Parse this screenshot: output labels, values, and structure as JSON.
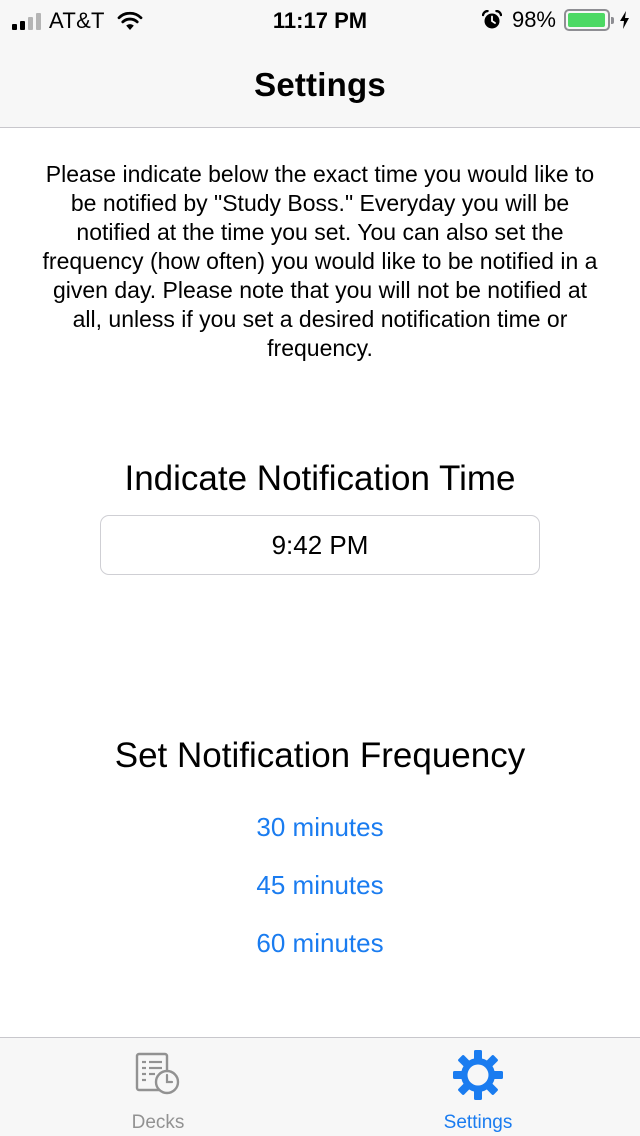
{
  "status_bar": {
    "carrier": "AT&T",
    "time": "11:17 PM",
    "battery_percent": "98%",
    "battery_level": 0.98,
    "signal_bars_filled": 2,
    "signal_bars_total": 4,
    "icons": [
      "signal-icon",
      "wifi-icon",
      "alarm-icon",
      "battery-icon",
      "charging-icon"
    ]
  },
  "nav_bar": {
    "title": "Settings"
  },
  "main": {
    "intro_text": "Please indicate below the exact time you would like to be notified by \"Study Boss.\" Everyday you will be notified at the time you set. You can also set the frequency (how often) you would like to be notified in a given day. Please note that you will not be notified at all, unless if you set a desired notification time or frequency.",
    "time_section_title": "Indicate Notification Time",
    "notification_time": "9:42 PM",
    "frequency_section_title": "Set Notification Frequency",
    "frequency_options": [
      "30 minutes",
      "45 minutes",
      "60 minutes"
    ]
  },
  "tab_bar": {
    "tabs": [
      {
        "label": "Decks",
        "icon": "decks-icon",
        "active": false
      },
      {
        "label": "Settings",
        "icon": "gear-icon",
        "active": true
      }
    ]
  },
  "colors": {
    "accent": "#1a7cf0",
    "inactive_tab": "#929292",
    "battery_green": "#4cd964",
    "bar_background": "#f7f7f7"
  }
}
